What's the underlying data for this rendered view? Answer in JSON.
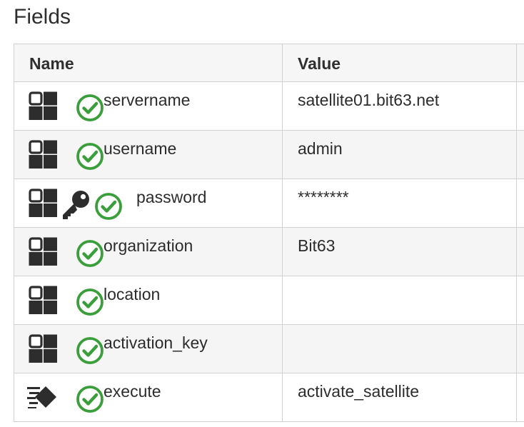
{
  "section": {
    "title": "Fields"
  },
  "table": {
    "headers": {
      "name": "Name",
      "value": "Value"
    },
    "rows": [
      {
        "name": "servername",
        "value": "satellite01.bit63.net",
        "type_icon": "field-grid-icon",
        "status_icon": "check-circle-icon"
      },
      {
        "name": "username",
        "value": "admin",
        "type_icon": "field-grid-icon",
        "status_icon": "check-circle-icon"
      },
      {
        "name": "password",
        "value": "********",
        "type_icon": "field-grid-icon",
        "extra_icon": "key-icon",
        "status_icon": "check-circle-icon"
      },
      {
        "name": "organization",
        "value": "Bit63",
        "type_icon": "field-grid-icon",
        "status_icon": "check-circle-icon"
      },
      {
        "name": "location",
        "value": "",
        "type_icon": "field-grid-icon",
        "status_icon": "check-circle-icon"
      },
      {
        "name": "activation_key",
        "value": "",
        "type_icon": "field-grid-icon",
        "status_icon": "check-circle-icon"
      },
      {
        "name": "execute",
        "value": "activate_satellite",
        "type_icon": "execute-icon",
        "status_icon": "check-circle-icon"
      }
    ]
  },
  "colors": {
    "check_green": "#3a9e3a",
    "icon_dark": "#2d2d2d",
    "header_bg": "#f6f6f6",
    "stripe_bg": "#f5f5f5",
    "border": "#d2d2d2"
  }
}
